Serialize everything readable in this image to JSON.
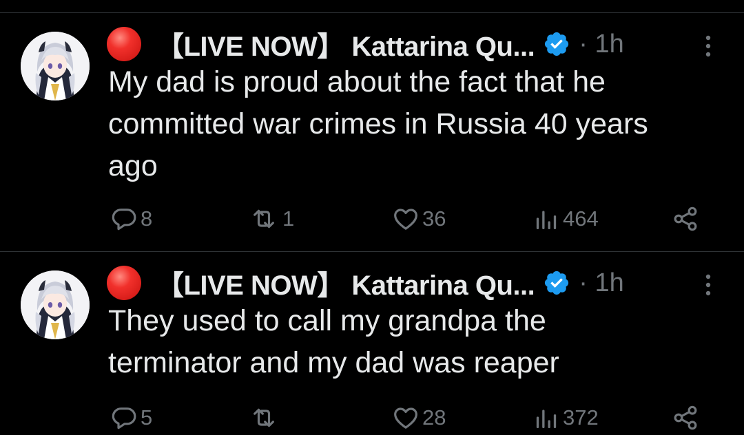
{
  "colors": {
    "background": "#000000",
    "text": "#e7e9ea",
    "muted": "#71767b",
    "divider": "#2f3336",
    "verified": "#1d9bf0",
    "live_dot": "#f1302b"
  },
  "tweets": [
    {
      "display_name": "【LIVE NOW】 Kattarina Qu...",
      "time": "· 1h",
      "text_lines": [
        "My dad is proud about the fact that he",
        "committed war crimes in Russia 40 years",
        "ago"
      ],
      "replies": "8",
      "reposts": "1",
      "likes": "36",
      "views": "464",
      "icons": {
        "live": "red-circle-icon",
        "verified": "verified-badge-icon",
        "more": "more-vertical-icon",
        "reply": "reply-icon",
        "repost": "repost-icon",
        "like": "heart-icon",
        "views": "views-icon",
        "share": "share-icon"
      }
    },
    {
      "display_name": "【LIVE NOW】 Kattarina Qu...",
      "time": "· 1h",
      "text_lines": [
        "They used to call my grandpa the",
        "terminator and my dad was reaper"
      ],
      "replies": "5",
      "reposts": "",
      "likes": "28",
      "views": "372",
      "icons": {
        "live": "red-circle-icon",
        "verified": "verified-badge-icon",
        "more": "more-vertical-icon",
        "reply": "reply-icon",
        "repost": "repost-icon",
        "like": "heart-icon",
        "views": "views-icon",
        "share": "share-icon"
      }
    }
  ]
}
